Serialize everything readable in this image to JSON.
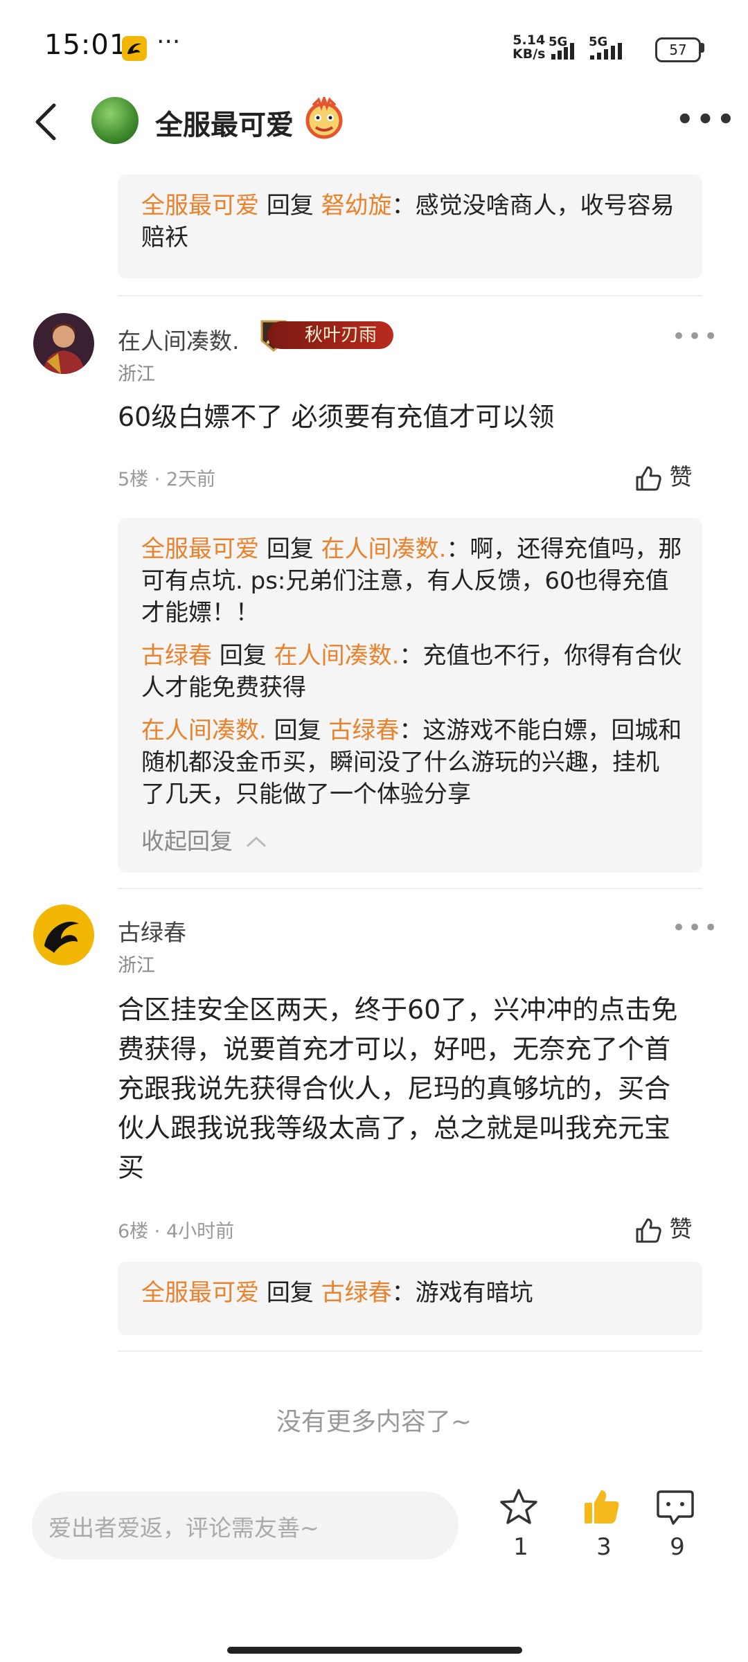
{
  "status_bar": {
    "time": "15:01",
    "dots": "···",
    "net_speed_value": "5.14",
    "net_speed_unit": "KB/s",
    "signal1": "5G",
    "signal2": "5G",
    "battery": "57"
  },
  "header": {
    "title": "全服最可爱",
    "back_icon": "chevron-left-icon",
    "more_icon": "more-horizontal-icon"
  },
  "top_reply": {
    "author": "全服最可爱",
    "reply_word": "回复",
    "target": "砮幼旋",
    "text": "：感觉没啥商人，收号容易",
    "text_line2": "赔袄"
  },
  "comments": [
    {
      "user": "在人间凑数.",
      "badge": "秋叶刃雨",
      "location": "浙江",
      "content": "60级白嫖不了 必须要有充值才可以领",
      "floor": "5楼",
      "time": "2天前",
      "like_label": "赞",
      "replies": [
        {
          "author": "全服最可爱",
          "reply_word": "回复",
          "target": "在人间凑数.",
          "line1": "：啊，还得充值吗，那",
          "line2": "可有点坑. ps:兄弟们注意，有人反馈，60也得充值",
          "line3": "才能嫖！！"
        },
        {
          "author": "古绿春",
          "reply_word": "回复",
          "target": "在人间凑数.",
          "line1": "：充值也不行，你得有合伙",
          "line2": "人才能免费获得"
        },
        {
          "author": "在人间凑数.",
          "reply_word": "回复",
          "target": "古绿春",
          "line1": "：这游戏不能白嫖，回城和",
          "line2": "随机都没金币买，瞬间没了什么游玩的兴趣，挂机",
          "line3": "了几天，只能做了一个体验分享"
        }
      ],
      "collapse_label": "收起回复"
    },
    {
      "user": "古绿春",
      "location": "浙江",
      "content_lines": [
        "合区挂安全区两天，终于60了，兴冲冲的点击免",
        "费获得，说要首充才可以，好吧，无奈充了个首",
        "充跟我说先获得合伙人，尼玛的真够坑的，买合",
        "伙人跟我说我等级太高了，总之就是叫我充元宝",
        "买"
      ],
      "floor": "6楼",
      "time": "4小时前",
      "like_label": "赞",
      "replies": [
        {
          "author": "全服最可爱",
          "reply_word": "回复",
          "target": "古绿春",
          "line1": "：游戏有暗坑"
        }
      ]
    }
  ],
  "footer_text": "没有更多内容了~",
  "bottom_bar": {
    "input_placeholder": "爱出者爱返，评论需友善~",
    "star_count": "1",
    "like_count": "3",
    "comment_count": "9",
    "like_color": "#f5b81d"
  }
}
